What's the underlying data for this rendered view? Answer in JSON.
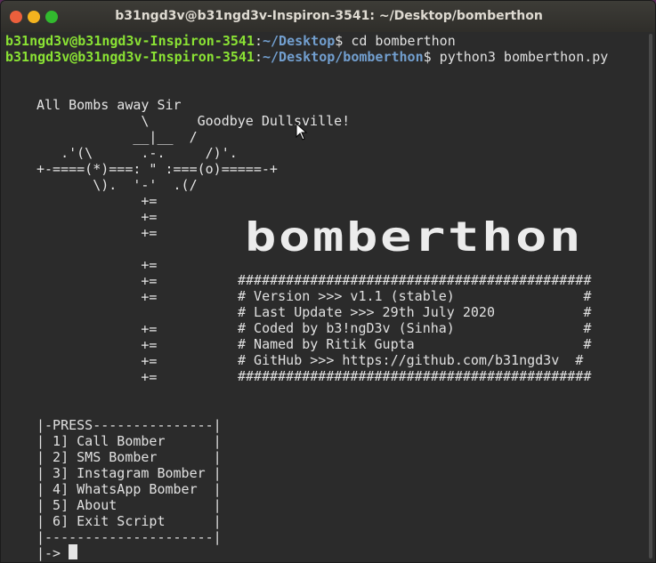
{
  "window": {
    "title": "b31ngd3v@b31ngd3v-Inspiron-3541: ~/Desktop/bomberthon"
  },
  "prompts": [
    {
      "user": "b31ngd3v@b31ngd3v-Inspiron-3541",
      "sep": ":",
      "path": "~/Desktop",
      "sym": "$",
      "cmd": " cd bomberthon"
    },
    {
      "user": "b31ngd3v@b31ngd3v-Inspiron-3541",
      "sep": ":",
      "path": "~/Desktop/bomberthon",
      "sym": "$",
      "cmd": " python3 bomberthon.py"
    }
  ],
  "art": [
    "All Bombs away Sir",
    "             \\      Goodbye Dullsville!",
    "            __|__  /",
    "   .'(\\      .-.     /)'.  ",
    "+-====(*)===: \" :===(o)=====-+",
    "       \\).  '-'  .(/",
    "             +=",
    "             +=",
    "             +=",
    "",
    "             +=",
    "             +=",
    "             +=",
    "",
    "             +=",
    "             +=",
    "             +=",
    "             +="
  ],
  "logo_text": "bomberthon",
  "info": [
    "############################################",
    "# Version >>> v1.1 (stable)                #",
    "# Last Update >>> 29th July 2020           #",
    "# Coded by b3!ngD3v (Sinha)                #",
    "# Named by Ritik Gupta                     #",
    "# GitHub >>> https://github.com/b31ngd3v  #",
    "############################################"
  ],
  "menu": {
    "header": "|-PRESS---------------|",
    "items": [
      "| 1] Call Bomber      |",
      "| 2] SMS Bomber       |",
      "| 3] Instagram Bomber |",
      "| 4] WhatsApp Bomber  |",
      "| 5] About            |",
      "| 6] Exit Script      |"
    ],
    "footer": "|---------------------|",
    "input_prompt": "|-> "
  }
}
